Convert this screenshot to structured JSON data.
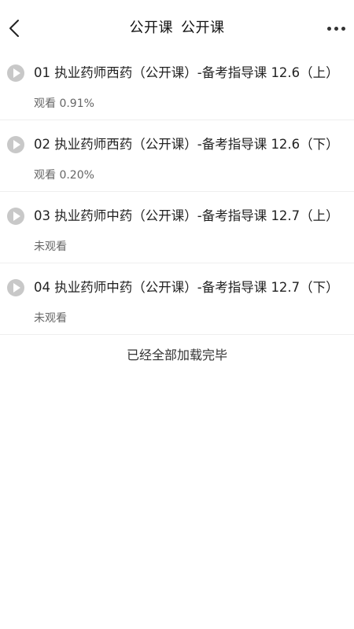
{
  "navbar": {
    "title_part1": "公开课",
    "title_part2": "公开课"
  },
  "icons": {
    "back": "chevron-left-icon",
    "more": "more-horizontal-icon",
    "play": "play-circle-icon"
  },
  "colors": {
    "play_icon_bg": "#c8c8c8",
    "divider": "#eeeeee",
    "secondary_text": "#666666"
  },
  "courses": [
    {
      "title": "01 执业药师西药（公开课）-备考指导课 12.6（上）",
      "status": "观看 0.91%"
    },
    {
      "title": "02 执业药师西药（公开课）-备考指导课 12.6（下）",
      "status": "观看 0.20%"
    },
    {
      "title": "03 执业药师中药（公开课）-备考指导课 12.7（上）",
      "status": "未观看"
    },
    {
      "title": "04 执业药师中药（公开课）-备考指导课 12.7（下）",
      "status": "未观看"
    }
  ],
  "footer": {
    "loaded_all": "已经全部加载完毕"
  }
}
